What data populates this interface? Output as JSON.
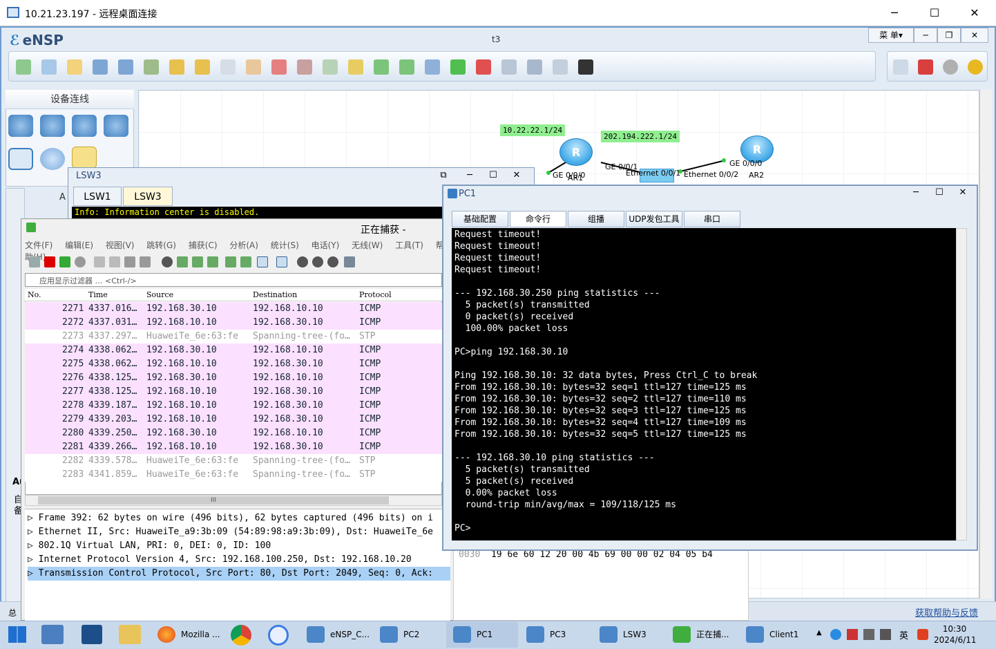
{
  "rdp": {
    "title": "10.21.23.197 - 远程桌面连接"
  },
  "ensp": {
    "title": "eNSP",
    "file": "t3",
    "menu": "菜 单▾",
    "device_panel_title": "设备连线",
    "help_link": "获取帮助与反馈",
    "left_labels": [
      "A",
      "Au",
      "自",
      "备",
      "总"
    ]
  },
  "topology": {
    "labels": [
      "10.22.22.1/24",
      "202.194.222.1/24"
    ],
    "ports": [
      "GE 0/0/0",
      "GE 0/0/1",
      "Ethernet 0/0/1",
      "Ethernet 0/0/2",
      "GE 0/0/0"
    ],
    "devices": [
      "AR1",
      "AR2"
    ]
  },
  "lsw3": {
    "title": "LSW3",
    "tabs": [
      "LSW1",
      "LSW3"
    ],
    "console_line": "Info: Information center is disabled."
  },
  "wireshark": {
    "title": "正在捕获 -",
    "menu": [
      "文件(F)",
      "编辑(E)",
      "视图(V)",
      "跳转(G)",
      "捕获(C)",
      "分析(A)",
      "统计(S)",
      "电话(Y)",
      "无线(W)",
      "工具(T)",
      "帮助(H)"
    ],
    "filter_placeholder": "应用显示过滤器 … <Ctrl-/>",
    "columns": [
      "No.",
      "Time",
      "Source",
      "Destination",
      "Protocol"
    ],
    "rows": [
      {
        "no": "2271",
        "time": "4337.016…",
        "src": "192.168.30.10",
        "dst": "192.168.10.10",
        "proto": "ICMP"
      },
      {
        "no": "2272",
        "time": "4337.031…",
        "src": "192.168.10.10",
        "dst": "192.168.30.10",
        "proto": "ICMP"
      },
      {
        "no": "2273",
        "time": "4337.297…",
        "src": "HuaweiTe_6e:63:fe",
        "dst": "Spanning-tree-(fo…",
        "proto": "STP"
      },
      {
        "no": "2274",
        "time": "4338.062…",
        "src": "192.168.30.10",
        "dst": "192.168.10.10",
        "proto": "ICMP"
      },
      {
        "no": "2275",
        "time": "4338.062…",
        "src": "192.168.10.10",
        "dst": "192.168.30.10",
        "proto": "ICMP"
      },
      {
        "no": "2276",
        "time": "4338.125…",
        "src": "192.168.30.10",
        "dst": "192.168.10.10",
        "proto": "ICMP"
      },
      {
        "no": "2277",
        "time": "4338.125…",
        "src": "192.168.10.10",
        "dst": "192.168.30.10",
        "proto": "ICMP"
      },
      {
        "no": "2278",
        "time": "4339.187…",
        "src": "192.168.10.10",
        "dst": "192.168.30.10",
        "proto": "ICMP"
      },
      {
        "no": "2279",
        "time": "4339.203…",
        "src": "192.168.10.10",
        "dst": "192.168.30.10",
        "proto": "ICMP"
      },
      {
        "no": "2280",
        "time": "4339.250…",
        "src": "192.168.30.10",
        "dst": "192.168.10.10",
        "proto": "ICMP"
      },
      {
        "no": "2281",
        "time": "4339.266…",
        "src": "192.168.10.10",
        "dst": "192.168.30.10",
        "proto": "ICMP"
      },
      {
        "no": "2282",
        "time": "4339.578…",
        "src": "HuaweiTe_6e:63:fe",
        "dst": "Spanning-tree-(fo…",
        "proto": "STP"
      },
      {
        "no": "2283",
        "time": "4341.859…",
        "src": "HuaweiTe_6e:63:fe",
        "dst": "Spanning-tree-(fo…",
        "proto": "STP"
      }
    ],
    "hscroll_thumb": "III",
    "details": [
      "Frame 392: 62 bytes on wire (496 bits), 62 bytes captured (496 bits) on i",
      "Ethernet II, Src: HuaweiTe_a9:3b:09 (54:89:98:a9:3b:09), Dst: HuaweiTe_6e",
      "802.1Q Virtual LAN, PRI: 0, DEI: 0, ID: 100",
      "Internet Protocol Version 4, Src: 192.168.100.250, Dst: 192.168.10.20",
      "Transmission Control Protocol, Src Port: 80, Dst Port: 2049, Seq: 0, Ack:"
    ],
    "hex_offset": "0030",
    "hex_bytes": "19 6e 60 12 20 00 4b 69  00 00 02 04 05 b4"
  },
  "pc1": {
    "title": "PC1",
    "tabs": [
      "基础配置",
      "命令行",
      "组播",
      "UDP发包工具",
      "串口"
    ],
    "terminal": "Request timeout!\nRequest timeout!\nRequest timeout!\nRequest timeout!\n\n--- 192.168.30.250 ping statistics ---\n  5 packet(s) transmitted\n  0 packet(s) received\n  100.00% packet loss\n\nPC>ping 192.168.30.10\n\nPing 192.168.30.10: 32 data bytes, Press Ctrl_C to break\nFrom 192.168.30.10: bytes=32 seq=1 ttl=127 time=125 ms\nFrom 192.168.30.10: bytes=32 seq=2 ttl=127 time=110 ms\nFrom 192.168.30.10: bytes=32 seq=3 ttl=127 time=125 ms\nFrom 192.168.30.10: bytes=32 seq=4 ttl=127 time=109 ms\nFrom 192.168.30.10: bytes=32 seq=5 ttl=127 time=125 ms\n\n--- 192.168.30.10 ping statistics ---\n  5 packet(s) transmitted\n  5 packet(s) received\n  0.00% packet loss\n  round-trip min/avg/max = 109/118/125 ms\n\nPC>"
  },
  "taskbar": {
    "items": [
      "Mozilla ...",
      "eNSP_C...",
      "PC2",
      "PC1",
      "PC3",
      "LSW3",
      "正在捕...",
      "Client1"
    ],
    "ime": "英",
    "time": "10:30",
    "date": "2024/6/11"
  }
}
